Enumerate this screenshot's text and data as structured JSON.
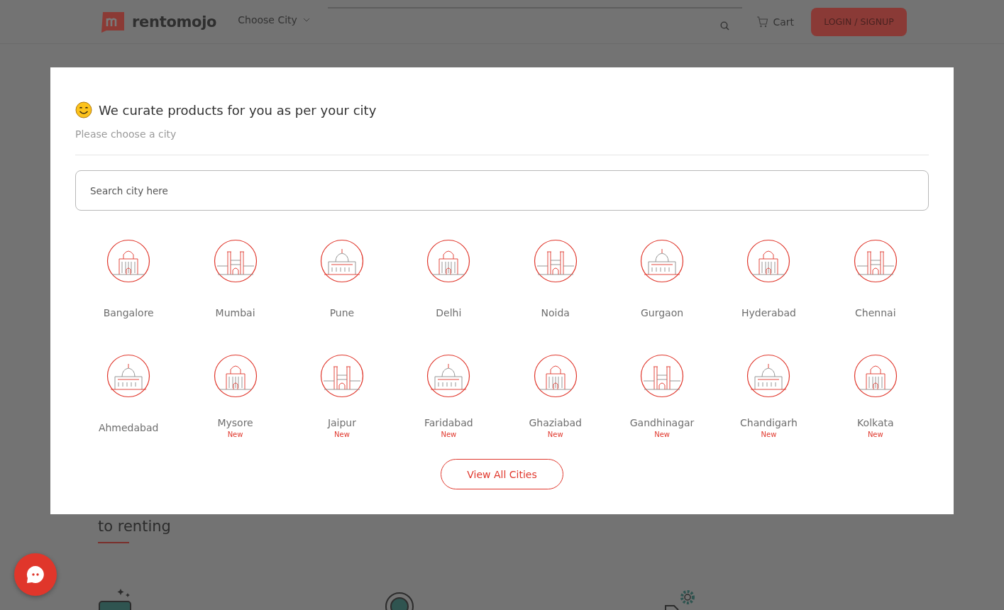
{
  "header": {
    "logo": "rentomojo",
    "city_selector": "Choose City",
    "cart": "Cart",
    "login": "LOGIN / SIGNUP"
  },
  "background": {
    "heading": "to renting"
  },
  "modal": {
    "title": "We curate products for you as per your city",
    "subtitle": "Please choose a city",
    "search": {
      "placeholder": "Search city here"
    },
    "cities": [
      {
        "name": "Bangalore"
      },
      {
        "name": "Mumbai"
      },
      {
        "name": "Pune"
      },
      {
        "name": "Delhi"
      },
      {
        "name": "Noida"
      },
      {
        "name": "Gurgaon"
      },
      {
        "name": "Hyderabad"
      },
      {
        "name": "Chennai"
      },
      {
        "name": "Ahmedabad"
      },
      {
        "name": "Mysore",
        "badge": "New"
      },
      {
        "name": "Jaipur",
        "badge": "New"
      },
      {
        "name": "Faridabad",
        "badge": "New"
      },
      {
        "name": "Ghaziabad",
        "badge": "New"
      },
      {
        "name": "Gandhinagar",
        "badge": "New"
      },
      {
        "name": "Chandigarh",
        "badge": "New"
      },
      {
        "name": "Kolkata",
        "badge": "New"
      }
    ],
    "view_all": "View All Cities"
  }
}
